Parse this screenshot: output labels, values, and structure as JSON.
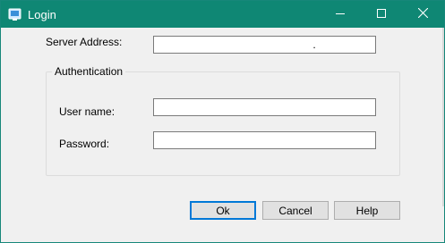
{
  "window": {
    "title": "Login",
    "colors": {
      "titlebar": "#0f8774",
      "border": "#17877a",
      "face": "#f0f0f0",
      "default_button_border": "#0078d7"
    },
    "icons": {
      "app": "login-app-icon",
      "minimize": "minimize-icon",
      "maximize": "maximize-icon",
      "close": "close-icon"
    }
  },
  "form": {
    "server_label": "Server Address:",
    "server_value": "                                                    .",
    "group_title": "Authentication",
    "username_label": "User name:",
    "username_value": "",
    "password_label": "Password:",
    "password_value": ""
  },
  "buttons": {
    "ok": "Ok",
    "cancel": "Cancel",
    "help": "Help"
  }
}
